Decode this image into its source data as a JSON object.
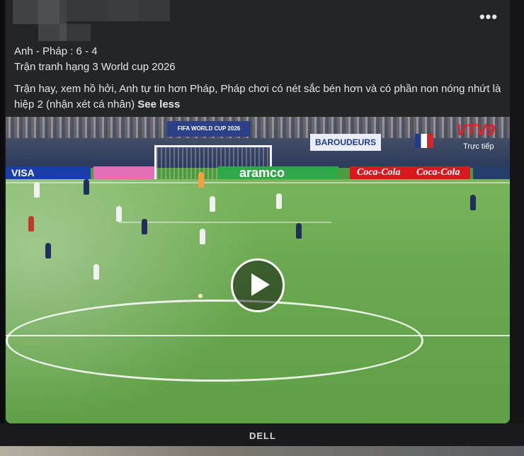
{
  "post": {
    "line1": "Anh - Pháp : 6 - 4",
    "line2": "Trận tranh hạng 3 World cup 2026",
    "body": " Trận hay, xem hồ hởi, Anh tự tin hơn Pháp, Pháp chơi có nét sắc bén hơn và có phần non nóng nhứt là hiệp 2 (nhận xét cá nhân)",
    "see_less": "See less",
    "more_icon": "more-horizontal-icon",
    "more_label": "•••"
  },
  "video": {
    "fifa_banner": "FIFA WORLD CUP 2026",
    "sponsor_banner": "BAROUDEURS",
    "ad_visa": "VISA",
    "ad_aramco": "aramco",
    "ad_cola_1": "Coca-Cola",
    "ad_cola_2": "Coca-Cola",
    "channel_logo": "VTV9",
    "live_label": "Trực tiếp",
    "play_icon": "play-icon"
  },
  "monitor": {
    "brand": "DELL"
  },
  "colors": {
    "card_bg": "#242526",
    "text": "#e4e6eb",
    "pitch": "#6aa84f",
    "vtv_red": "#e31f26"
  }
}
